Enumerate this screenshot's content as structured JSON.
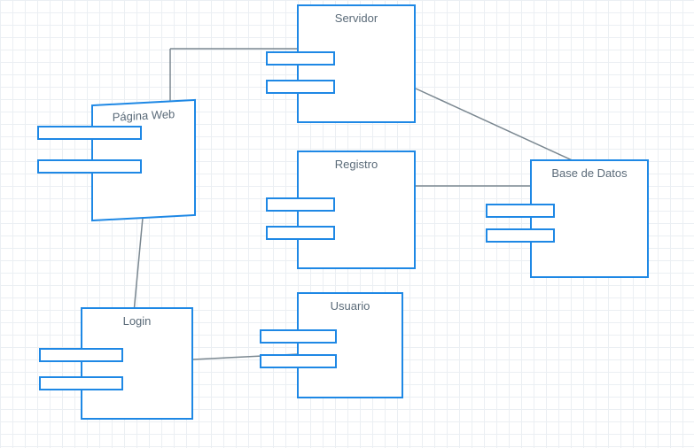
{
  "diagram": {
    "type": "uml-component",
    "components": {
      "pagina_web": {
        "label": "Página Web"
      },
      "servidor": {
        "label": "Servidor"
      },
      "registro": {
        "label": "Registro"
      },
      "base_datos": {
        "label": "Base de Datos"
      },
      "login": {
        "label": "Login"
      },
      "usuario": {
        "label": "Usuario"
      }
    },
    "connections": [
      [
        "pagina_web",
        "servidor"
      ],
      [
        "pagina_web",
        "login"
      ],
      [
        "servidor",
        "base_datos"
      ],
      [
        "registro",
        "base_datos"
      ],
      [
        "login",
        "usuario"
      ]
    ]
  }
}
